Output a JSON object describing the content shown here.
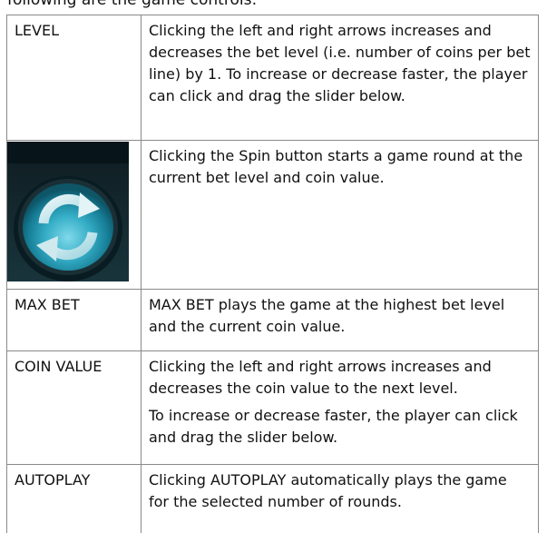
{
  "header_partial": "following are the game controls:",
  "rows": [
    {
      "label": "LEVEL",
      "paragraphs": [
        "Clicking the left and right arrows increases and decreases the bet level (i.e. number of coins per bet line) by 1. To increase or decrease faster, the player can click and drag the slider below."
      ]
    },
    {
      "icon": "spin-button-icon",
      "paragraphs": [
        "Clicking the Spin button starts a game round at the current bet level and coin value."
      ]
    },
    {
      "label": "MAX BET",
      "paragraphs": [
        "MAX BET plays the game at the highest bet level and the current coin value."
      ]
    },
    {
      "label": "COIN VALUE",
      "paragraphs": [
        "Clicking the left and right arrows increases and decreases the coin value to the next level.",
        "To increase or decrease faster, the player can click and drag the slider below."
      ]
    },
    {
      "label": "AUTOPLAY",
      "paragraphs": [
        "Clicking AUTOPLAY automatically plays the game for the selected number of rounds."
      ]
    }
  ]
}
